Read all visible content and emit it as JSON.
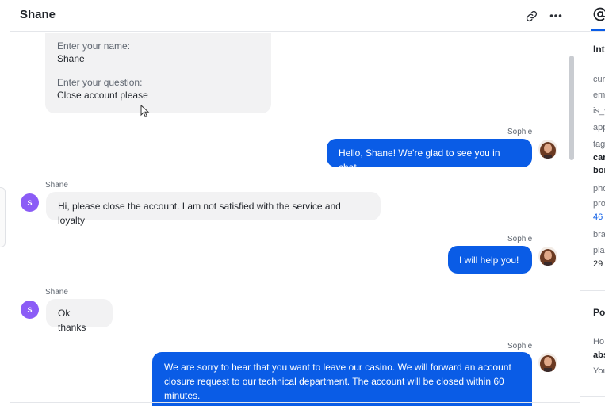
{
  "header": {
    "title": "Shane",
    "link_icon": "link-icon",
    "more_icon": "more-horizontal-icon"
  },
  "form_card": {
    "name_label": "Enter your name:",
    "name_value": "Shane",
    "question_label": "Enter your question:",
    "question_value": "Close account please"
  },
  "messages": [
    {
      "sender": "Sophie",
      "text": "Hello, Shane! We're glad to see you in chat."
    },
    {
      "sender": "Shane",
      "avatar_letter": "S",
      "text": "Hi, please close the account. I am not satisfied with the service and loyalty"
    },
    {
      "sender": "Sophie",
      "text": "I will help you!"
    },
    {
      "sender": "Shane",
      "avatar_letter": "S",
      "text": "Ok thanks"
    },
    {
      "sender": "Sophie",
      "text": "We are sorry to hear that you want to leave our casino. We will forward an account closure request to our technical department. The account will be closed within 60 minutes."
    }
  ],
  "right_panel": {
    "tab_icon": "at-sign-icon",
    "section1_title": "Int",
    "fields": [
      "cur",
      "em",
      "is_v",
      "app",
      "tag"
    ],
    "tag_values": [
      "car",
      "bor"
    ],
    "more_fields": [
      "pho",
      "pro"
    ],
    "pro_value": "46",
    "bra": "bra",
    "pla": "pla",
    "pla_value": "29",
    "section2_title": "Po",
    "ho": "Ho",
    "abs": "abs",
    "you": "You"
  },
  "colors": {
    "agent_bubble": "#0a5ce6",
    "client_bubble": "#f2f2f3",
    "avatar_letter_bg": "#8b5cf6"
  }
}
